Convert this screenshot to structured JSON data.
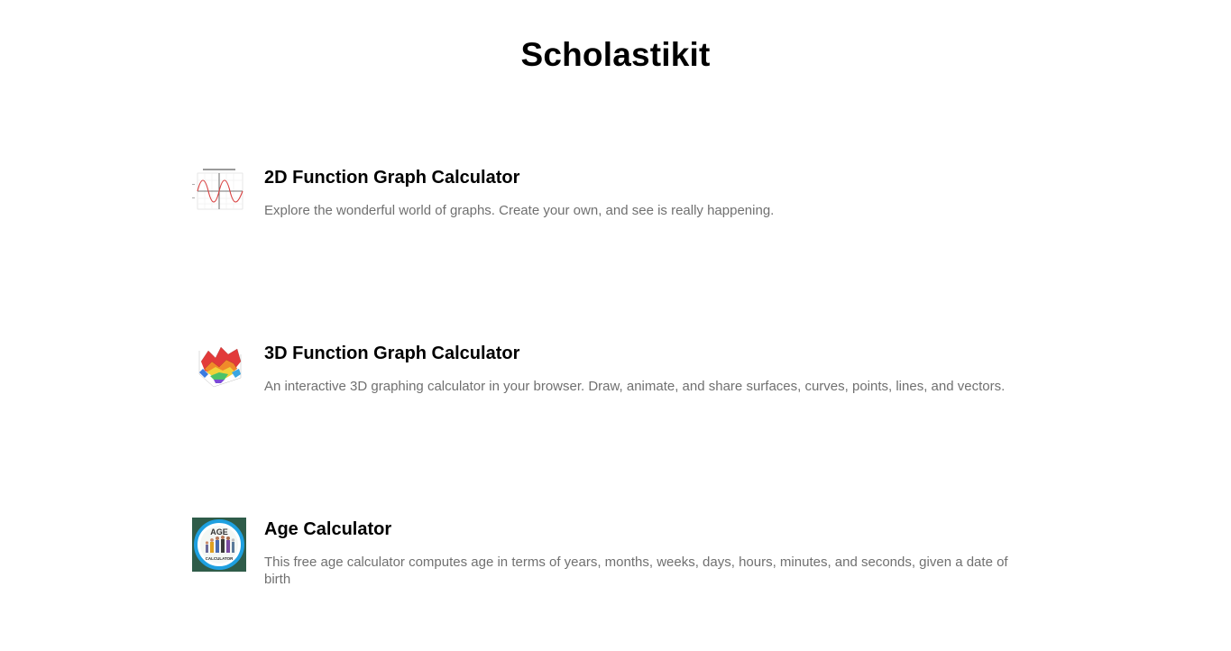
{
  "site": {
    "title": "Scholastikit"
  },
  "tools": [
    {
      "title": "2D Function Graph Calculator",
      "description": "Explore the wonderful world of graphs. Create your own, and see is really happening.",
      "icon": "2d-graph-thumbnail-icon"
    },
    {
      "title": "3D Function Graph Calculator",
      "description": "An interactive 3D graphing calculator in your browser. Draw, animate, and share surfaces, curves, points, lines, and vectors.",
      "icon": "3d-surface-thumbnail-icon"
    },
    {
      "title": "Age Calculator",
      "description": "This free age calculator computes age in terms of years, months, weeks, days, hours, minutes, and seconds, given a date of birth",
      "icon": "age-calculator-thumbnail-icon",
      "icon_text": [
        "AGE",
        "CALCULATOR"
      ]
    }
  ],
  "colors": {
    "title": "#000000",
    "description": "#707070",
    "age_icon_background": "#2f5c49",
    "age_icon_ring": "#1ea0e0"
  }
}
